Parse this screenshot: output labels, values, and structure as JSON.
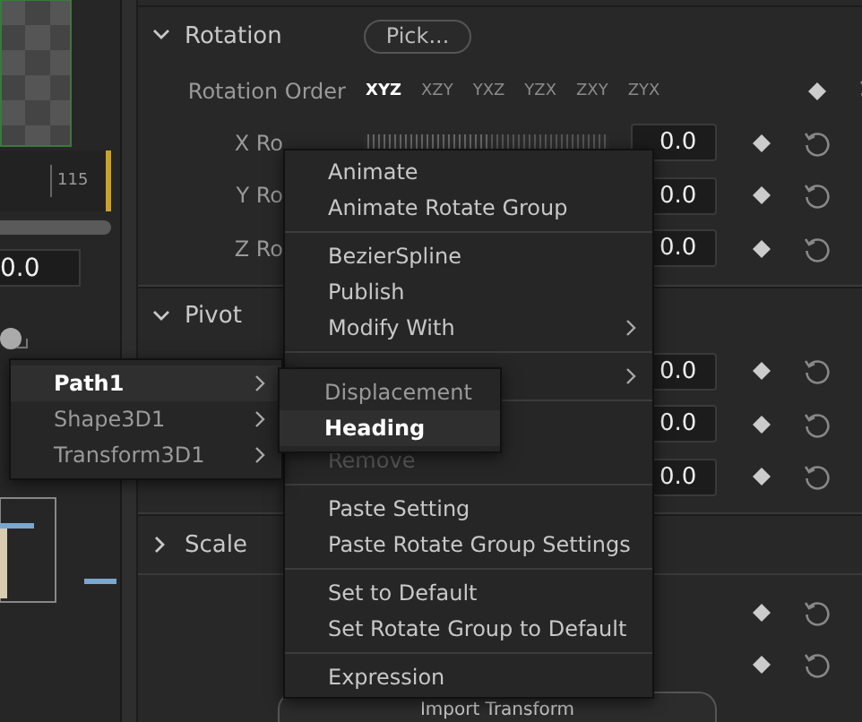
{
  "left_panel": {
    "timeline_label": "115",
    "field_value": "0.0"
  },
  "rotation": {
    "title": "Rotation",
    "expanded": true,
    "pick_button": "Pick...",
    "order_label": "Rotation Order",
    "orders": [
      {
        "label": "XYZ",
        "selected": true
      },
      {
        "label": "XZY",
        "selected": false
      },
      {
        "label": "YXZ",
        "selected": false
      },
      {
        "label": "YZX",
        "selected": false
      },
      {
        "label": "ZXY",
        "selected": false
      },
      {
        "label": "ZYX",
        "selected": false
      }
    ],
    "rows": [
      {
        "label": "X Ro",
        "kind": "slider",
        "level": 0.5,
        "value": "0.0"
      },
      {
        "label": "Y Ro",
        "kind": "field",
        "value": "0.0"
      },
      {
        "label": "Z Ro",
        "kind": "field",
        "value": "0.0"
      }
    ]
  },
  "pivot": {
    "title": "Pivot",
    "expanded": true,
    "rows": [
      {
        "kind": "field",
        "value": "0.0"
      },
      {
        "kind": "field",
        "value": "0.0"
      },
      {
        "kind": "field",
        "value": "0.0"
      }
    ]
  },
  "scale": {
    "title": "Scale",
    "expanded": false,
    "rows": [
      {
        "kind": "keys"
      },
      {
        "kind": "keys"
      }
    ]
  },
  "import_button": "Import Transform",
  "context_menu": {
    "items": [
      {
        "kind": "item",
        "label": "Animate"
      },
      {
        "kind": "item",
        "label": "Animate Rotate Group"
      },
      {
        "kind": "separator"
      },
      {
        "kind": "item",
        "label": "BezierSpline"
      },
      {
        "kind": "item",
        "label": "Publish"
      },
      {
        "kind": "submenu",
        "label": "Modify With"
      },
      {
        "kind": "separator"
      },
      {
        "kind": "submenu"
      },
      {
        "kind": "separator"
      },
      {
        "kind": "disabled",
        "label": "Remove"
      },
      {
        "kind": "separator"
      },
      {
        "kind": "item",
        "label": "Paste Setting"
      },
      {
        "kind": "item",
        "label": "Paste Rotate Group Settings"
      },
      {
        "kind": "separator"
      },
      {
        "kind": "item",
        "label": "Set to Default"
      },
      {
        "kind": "item",
        "label": "Set Rotate Group to Default"
      },
      {
        "kind": "separator"
      },
      {
        "kind": "item",
        "label": "Expression"
      }
    ]
  },
  "path_menu": {
    "items": [
      {
        "label": "Path1",
        "selected": true
      },
      {
        "label": "Shape3D1",
        "selected": false
      },
      {
        "label": "Transform3D1",
        "selected": false
      }
    ]
  },
  "path_submenu": {
    "items": [
      {
        "label": "Displacement",
        "selected": false
      },
      {
        "label": "Heading",
        "selected": true
      }
    ]
  }
}
